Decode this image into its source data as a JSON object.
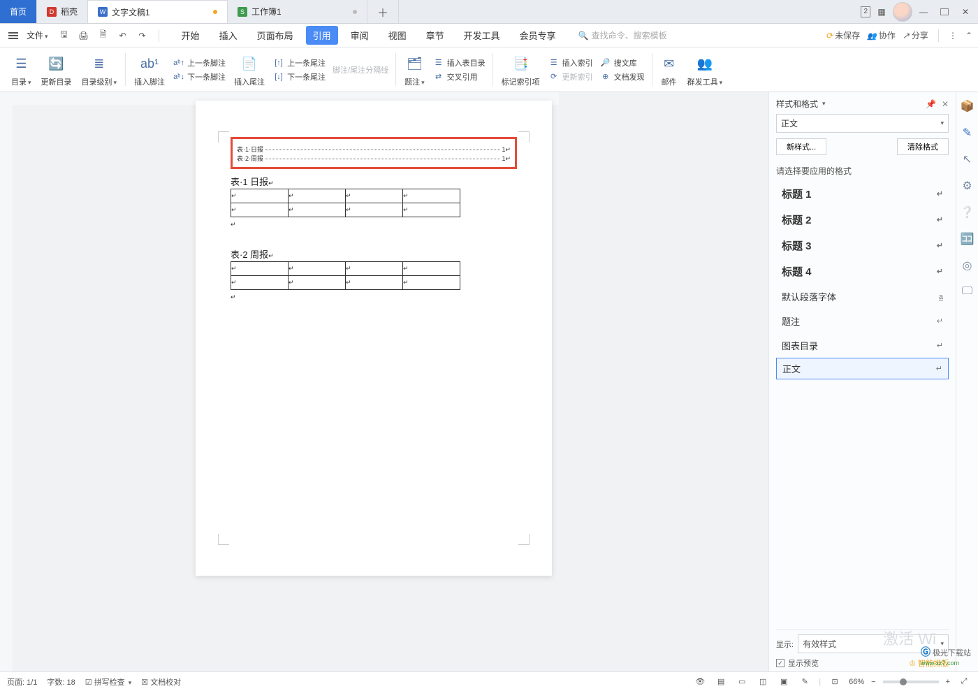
{
  "tabs": {
    "home": "首页",
    "shell": "稻壳",
    "doc": "文字文稿1",
    "sheet": "工作簿1"
  },
  "win_badge": "2",
  "menubar": {
    "file": "文件",
    "items": [
      "开始",
      "插入",
      "页面布局",
      "引用",
      "审阅",
      "视图",
      "章节",
      "开发工具",
      "会员专享"
    ],
    "active_index": 3,
    "search_placeholder": "查找命令、搜索模板",
    "unsaved": "未保存",
    "collab": "协作",
    "share": "分享"
  },
  "ribbon": {
    "g1": [
      "目录",
      "更新目录",
      "目录级别"
    ],
    "g2_big": "插入脚注",
    "g2_stack": [
      "上一条脚注",
      "下一条脚注"
    ],
    "g3_big": "插入尾注",
    "g3_stack": [
      "上一条尾注",
      "下一条尾注"
    ],
    "g3_disabled": "脚注/尾注分隔线",
    "g4": "题注",
    "g4_stack": [
      "插入表目录",
      "交叉引用"
    ],
    "g5": "标记索引项",
    "g5_stack": [
      "插入索引",
      "更新索引"
    ],
    "g5b_stack": [
      "搜文库",
      "文档发现"
    ],
    "g6": [
      "邮件",
      "群发工具"
    ]
  },
  "document": {
    "toc": [
      {
        "label": "表·1·日报",
        "page": "1"
      },
      {
        "label": "表·2·周报",
        "page": "1"
      }
    ],
    "caption1": "表·1 日报",
    "caption2": "表·2 周报"
  },
  "panel": {
    "title": "样式和格式",
    "current": "正文",
    "new_style": "新样式...",
    "clear": "清除格式",
    "choose": "请选择要应用的格式",
    "styles": [
      {
        "name": "标题 1",
        "cls": "h",
        "mark": "↵"
      },
      {
        "name": "标题 2",
        "cls": "h",
        "mark": "↵"
      },
      {
        "name": "标题 3",
        "cls": "h",
        "mark": "↵"
      },
      {
        "name": "标题 4",
        "cls": "h",
        "mark": "↵"
      },
      {
        "name": "默认段落字体",
        "cls": "",
        "mark": "a"
      },
      {
        "name": "题注",
        "cls": "",
        "mark": "↵"
      },
      {
        "name": "图表目录",
        "cls": "",
        "mark": "↵"
      },
      {
        "name": "正文",
        "cls": "sel",
        "mark": "↵"
      }
    ],
    "show": "显示:",
    "show_value": "有效样式",
    "preview": "显示预览",
    "smart": "智能排版"
  },
  "status": {
    "page": "页面: 1/1",
    "words": "字数: 18",
    "spell": "拼写检查",
    "proof": "文档校对",
    "zoom": "66%"
  },
  "watermark": "激活 Wi",
  "wm2a": "极光下载站",
  "wm2b": "www.xz7.com"
}
